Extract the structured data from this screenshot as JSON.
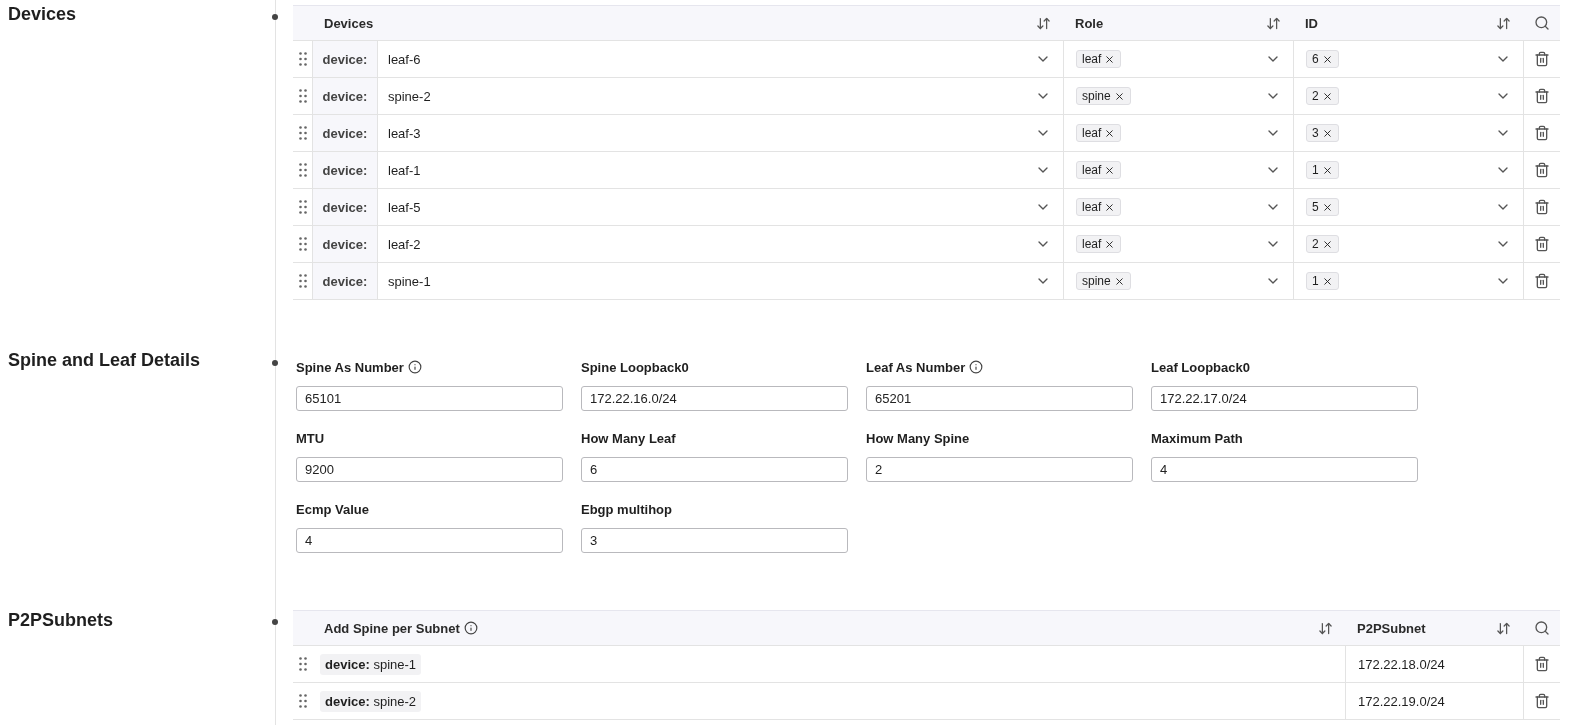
{
  "devices": {
    "title": "Devices",
    "columns": [
      {
        "label": "Devices"
      },
      {
        "label": "Role"
      },
      {
        "label": "ID"
      }
    ],
    "rows": [
      {
        "prefix": "device:",
        "device": "leaf-6",
        "role": "leaf",
        "id": "6"
      },
      {
        "prefix": "device:",
        "device": "spine-2",
        "role": "spine",
        "id": "2"
      },
      {
        "prefix": "device:",
        "device": "leaf-3",
        "role": "leaf",
        "id": "3"
      },
      {
        "prefix": "device:",
        "device": "leaf-1",
        "role": "leaf",
        "id": "1"
      },
      {
        "prefix": "device:",
        "device": "leaf-5",
        "role": "leaf",
        "id": "5"
      },
      {
        "prefix": "device:",
        "device": "leaf-2",
        "role": "leaf",
        "id": "2"
      },
      {
        "prefix": "device:",
        "device": "spine-1",
        "role": "spine",
        "id": "1"
      }
    ]
  },
  "details": {
    "title": "Spine and Leaf Details",
    "fields": [
      {
        "label": "Spine As Number",
        "info": true,
        "value": "65101"
      },
      {
        "label": "Spine Loopback0",
        "info": false,
        "value": "172.22.16.0/24"
      },
      {
        "label": "Leaf As Number",
        "info": true,
        "value": "65201"
      },
      {
        "label": "Leaf Loopback0",
        "info": false,
        "value": "172.22.17.0/24"
      },
      {
        "label": "MTU",
        "info": false,
        "value": "9200"
      },
      {
        "label": "How Many Leaf",
        "info": false,
        "value": "6"
      },
      {
        "label": "How Many Spine",
        "info": false,
        "value": "2"
      },
      {
        "label": "Maximum Path",
        "info": false,
        "value": "4"
      },
      {
        "label": "Ecmp Value",
        "info": false,
        "value": "4"
      },
      {
        "label": "Ebgp multihop",
        "info": false,
        "value": "3"
      }
    ]
  },
  "p2p": {
    "title": "P2PSubnets",
    "columns": [
      {
        "label": "Add Spine per Subnet",
        "info": true
      },
      {
        "label": "P2PSubnet",
        "info": false
      }
    ],
    "rows": [
      {
        "device": "**device:** spine-1",
        "subnet": "172.22.18.0/24"
      },
      {
        "device": "**device:** spine-2",
        "subnet": "172.22.19.0/24"
      }
    ]
  }
}
